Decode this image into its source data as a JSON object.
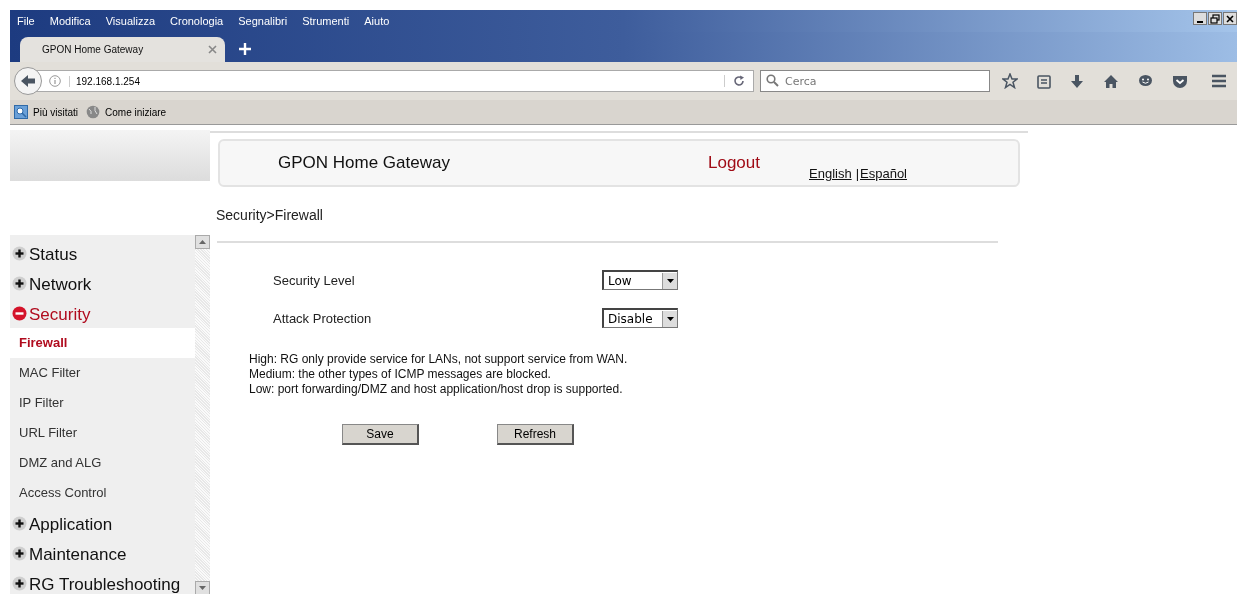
{
  "browser": {
    "menu": [
      "File",
      "Modifica",
      "Visualizza",
      "Cronologia",
      "Segnalibri",
      "Strumenti",
      "Aiuto"
    ],
    "tabs": [
      {
        "label": "GPON Home Gateway",
        "selected": true
      }
    ],
    "address": "192.168.1.254",
    "search": {
      "placeholder": "Cerca"
    },
    "bookmarks": [
      "Più visitati",
      "Come iniziare"
    ]
  },
  "header": {
    "title": "GPON Home Gateway",
    "logout": "Logout",
    "languages": [
      "English",
      "Español"
    ],
    "language_separator": "|"
  },
  "sidebar": {
    "items": [
      {
        "label": "Status",
        "expanded": false
      },
      {
        "label": "Network",
        "expanded": false
      },
      {
        "label": "Security",
        "expanded": true,
        "children": [
          {
            "label": "Firewall",
            "selected": true
          },
          {
            "label": "MAC Filter",
            "selected": false
          },
          {
            "label": "IP Filter",
            "selected": false
          },
          {
            "label": "URL Filter",
            "selected": false
          },
          {
            "label": "DMZ and ALG",
            "selected": false
          },
          {
            "label": "Access Control",
            "selected": false
          }
        ]
      },
      {
        "label": "Application",
        "expanded": false
      },
      {
        "label": "Maintenance",
        "expanded": false
      },
      {
        "label": "RG Troubleshooting",
        "expanded": false
      }
    ]
  },
  "breadcrumb": "Security>Firewall",
  "form": {
    "fields": [
      {
        "label": "Security Level",
        "value": "Low"
      },
      {
        "label": "Attack Protection",
        "value": "Disable"
      }
    ],
    "notes": [
      "High: RG only provide service for LANs, not support service from WAN.",
      "Medium: the other types of ICMP messages are blocked.",
      "Low: port forwarding/DMZ and host application/host drop is supported."
    ],
    "buttons": [
      "Save",
      "Refresh"
    ]
  }
}
